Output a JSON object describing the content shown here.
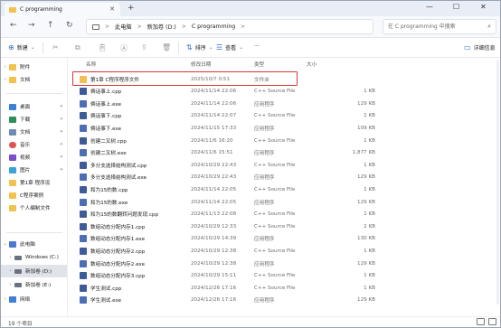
{
  "window": {
    "tab_title": "C programming",
    "tab_close": "✕",
    "new_tab": "+",
    "minimize": "—",
    "maximize": "☐",
    "close": "✕"
  },
  "address": {
    "back": "←",
    "forward": "→",
    "up": "↑",
    "refresh": "↻",
    "crumbs": [
      "此电脑",
      "新加卷 (D:)",
      "C programming"
    ],
    "separator": ">",
    "search_placeholder": "在 C programming 中搜索"
  },
  "toolbar": {
    "new_label": "新建",
    "sort_label": "排序",
    "view_label": "查看",
    "more": "···",
    "details_label": "详细信息"
  },
  "sidebar": {
    "items": [
      {
        "label": "附件",
        "icon": "folder-icon",
        "color": "#f2c14e"
      },
      {
        "label": "文档",
        "icon": "folder-icon",
        "color": "#f2c14e"
      },
      {
        "label": "桌面",
        "icon": "desktop-icon",
        "color": "#3b82d6"
      },
      {
        "label": "下载",
        "icon": "download-icon",
        "color": "#2f8f5b"
      },
      {
        "label": "文档",
        "icon": "documents-icon",
        "color": "#6c8bb5"
      },
      {
        "label": "音乐",
        "icon": "music-icon",
        "color": "#e0544f"
      },
      {
        "label": "视频",
        "icon": "video-icon",
        "color": "#7b4fc9"
      },
      {
        "label": "图片",
        "icon": "pictures-icon",
        "color": "#3aa3d8"
      },
      {
        "label": "第1章 程序设",
        "icon": "folder-icon",
        "color": "#f2c14e"
      },
      {
        "label": "C程序案例",
        "icon": "folder-icon",
        "color": "#f2c14e"
      },
      {
        "label": "个人编制文件",
        "icon": "folder-icon",
        "color": "#f2c14e"
      },
      {
        "label": "此电脑",
        "icon": "this-pc-icon",
        "color": "#4a7bd0"
      },
      {
        "label": "Windows (C:)",
        "icon": "drive-icon",
        "color": "#6a7280"
      },
      {
        "label": "新加卷 (D:)",
        "icon": "drive-icon",
        "color": "#6a7280"
      },
      {
        "label": "新加卷 (E:)",
        "icon": "drive-icon",
        "color": "#6a7280"
      },
      {
        "label": "网络",
        "icon": "network-icon",
        "color": "#3b82d6"
      }
    ]
  },
  "columns": {
    "name": "名称",
    "date": "修改日期",
    "type": "类型",
    "size": "大小"
  },
  "files": [
    {
      "name": "第1章 C程序程序文件",
      "date": "2025/10/7 0:51",
      "type": "文件夹",
      "size": "",
      "kind": "folder"
    },
    {
      "name": "俩话事上.cpp",
      "date": "2024/11/14 22:06",
      "type": "C++ Source File",
      "size": "1 KB",
      "kind": "cpp"
    },
    {
      "name": "俩话事上.exe",
      "date": "2024/11/14 22:06",
      "type": "应用程序",
      "size": "129 KB",
      "kind": "exe"
    },
    {
      "name": "俩话事下.cpp",
      "date": "2024/11/14 22:07",
      "type": "C++ Source File",
      "size": "1 KB",
      "kind": "cpp"
    },
    {
      "name": "俩话事下.exe",
      "date": "2024/11/15 17:33",
      "type": "应用程序",
      "size": "109 KB",
      "kind": "exe"
    },
    {
      "name": "创建二叉树.cpp",
      "date": "2024/11/6 16:20",
      "type": "C++ Source File",
      "size": "1 KB",
      "kind": "cpp"
    },
    {
      "name": "创建二叉树.exe",
      "date": "2024/11/6 15:51",
      "type": "应用程序",
      "size": "1,877 KB",
      "kind": "exe"
    },
    {
      "name": "多分支选择结构测试.cpp",
      "date": "2024/10/29 22:43",
      "type": "C++ Source File",
      "size": "1 KB",
      "kind": "cpp"
    },
    {
      "name": "多分支选择结构测试.exe",
      "date": "2024/10/29 22:43",
      "type": "应用程序",
      "size": "129 KB",
      "kind": "exe"
    },
    {
      "name": "和为15的数.cpp",
      "date": "2024/11/14 22:05",
      "type": "C++ Source File",
      "size": "1 KB",
      "kind": "cpp"
    },
    {
      "name": "和为15的数.exe",
      "date": "2024/11/14 22:05",
      "type": "应用程序",
      "size": "129 KB",
      "kind": "exe"
    },
    {
      "name": "和为15的数翻转问题发现.cpp",
      "date": "2024/11/13 22:08",
      "type": "C++ Source File",
      "size": "1 KB",
      "kind": "cpp"
    },
    {
      "name": "数组动态分配内存1.cpp",
      "date": "2024/10/29 12:33",
      "type": "C++ Source File",
      "size": "2 KB",
      "kind": "cpp"
    },
    {
      "name": "数组动态分配内存1.exe",
      "date": "2024/10/29 14:39",
      "type": "应用程序",
      "size": "130 KB",
      "kind": "exe"
    },
    {
      "name": "数组动态分配内存2.cpp",
      "date": "2024/10/29 12:38",
      "type": "C++ Source File",
      "size": "1 KB",
      "kind": "cpp"
    },
    {
      "name": "数组动态分配内存2.exe",
      "date": "2024/10/29 12:38",
      "type": "应用程序",
      "size": "129 KB",
      "kind": "exe"
    },
    {
      "name": "数组动态分配内存3.cpp",
      "date": "2024/10/29 15:11",
      "type": "C++ Source File",
      "size": "1 KB",
      "kind": "cpp"
    },
    {
      "name": "学生测试.cpp",
      "date": "2024/12/26 17:16",
      "type": "C++ Source File",
      "size": "1 KB",
      "kind": "cpp"
    },
    {
      "name": "学生测试.exe",
      "date": "2024/12/26 17:16",
      "type": "应用程序",
      "size": "129 KB",
      "kind": "exe"
    }
  ],
  "status": {
    "item_count": "19 个项目"
  }
}
